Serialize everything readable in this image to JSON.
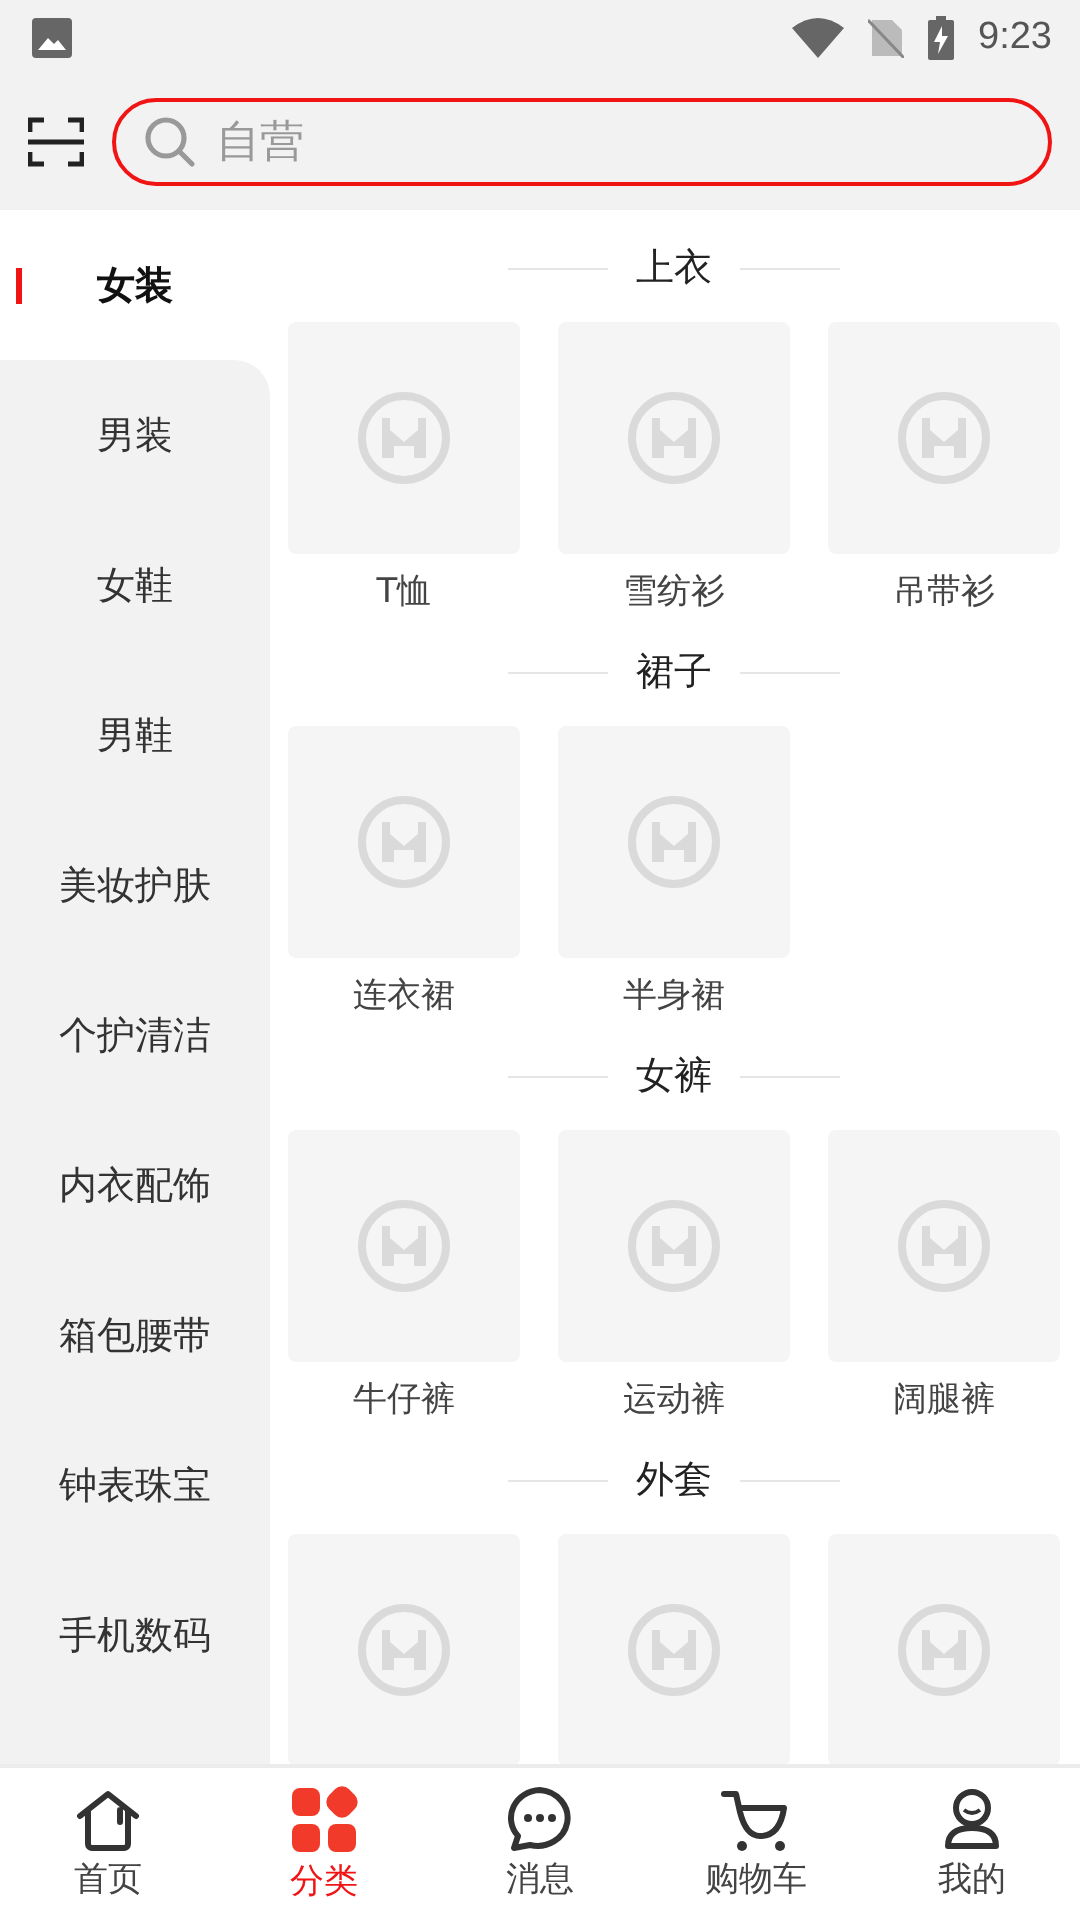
{
  "status_bar": {
    "time": "9:23"
  },
  "search": {
    "placeholder": "自营"
  },
  "sidebar": {
    "items": [
      {
        "label": "女装",
        "selected": true
      },
      {
        "label": "男装",
        "selected": false
      },
      {
        "label": "女鞋",
        "selected": false
      },
      {
        "label": "男鞋",
        "selected": false
      },
      {
        "label": "美妆护肤",
        "selected": false
      },
      {
        "label": "个护清洁",
        "selected": false
      },
      {
        "label": "内衣配饰",
        "selected": false
      },
      {
        "label": "箱包腰带",
        "selected": false
      },
      {
        "label": "钟表珠宝",
        "selected": false
      },
      {
        "label": "手机数码",
        "selected": false
      }
    ]
  },
  "sections": [
    {
      "title": "上衣",
      "items": [
        {
          "kind": "picture",
          "label": "T恤"
        },
        {
          "kind": "picture",
          "label": "雪纺衫"
        },
        {
          "kind": "picture",
          "label": "吊带衫"
        }
      ]
    },
    {
      "title": "裙子",
      "items": [
        {
          "kind": "picture",
          "label": "连衣裙"
        },
        {
          "kind": "picture",
          "label": "半身裙"
        }
      ]
    },
    {
      "title": "女裤",
      "items": [
        {
          "kind": "picture",
          "label": "牛仔裤"
        },
        {
          "kind": "picture",
          "label": "运动裤"
        },
        {
          "kind": "picture",
          "label": "阔腿裤"
        }
      ]
    },
    {
      "title": "外套"
    }
  ],
  "tab_bar": [
    {
      "label": "首页",
      "kind": "home",
      "selected": false
    },
    {
      "label": "分类",
      "kind": "category",
      "selected": true
    },
    {
      "label": "消息",
      "kind": "message",
      "selected": false
    },
    {
      "label": "购物车",
      "kind": "cart",
      "selected": false
    },
    {
      "label": "我的",
      "kind": "profile",
      "selected": false
    }
  ]
}
